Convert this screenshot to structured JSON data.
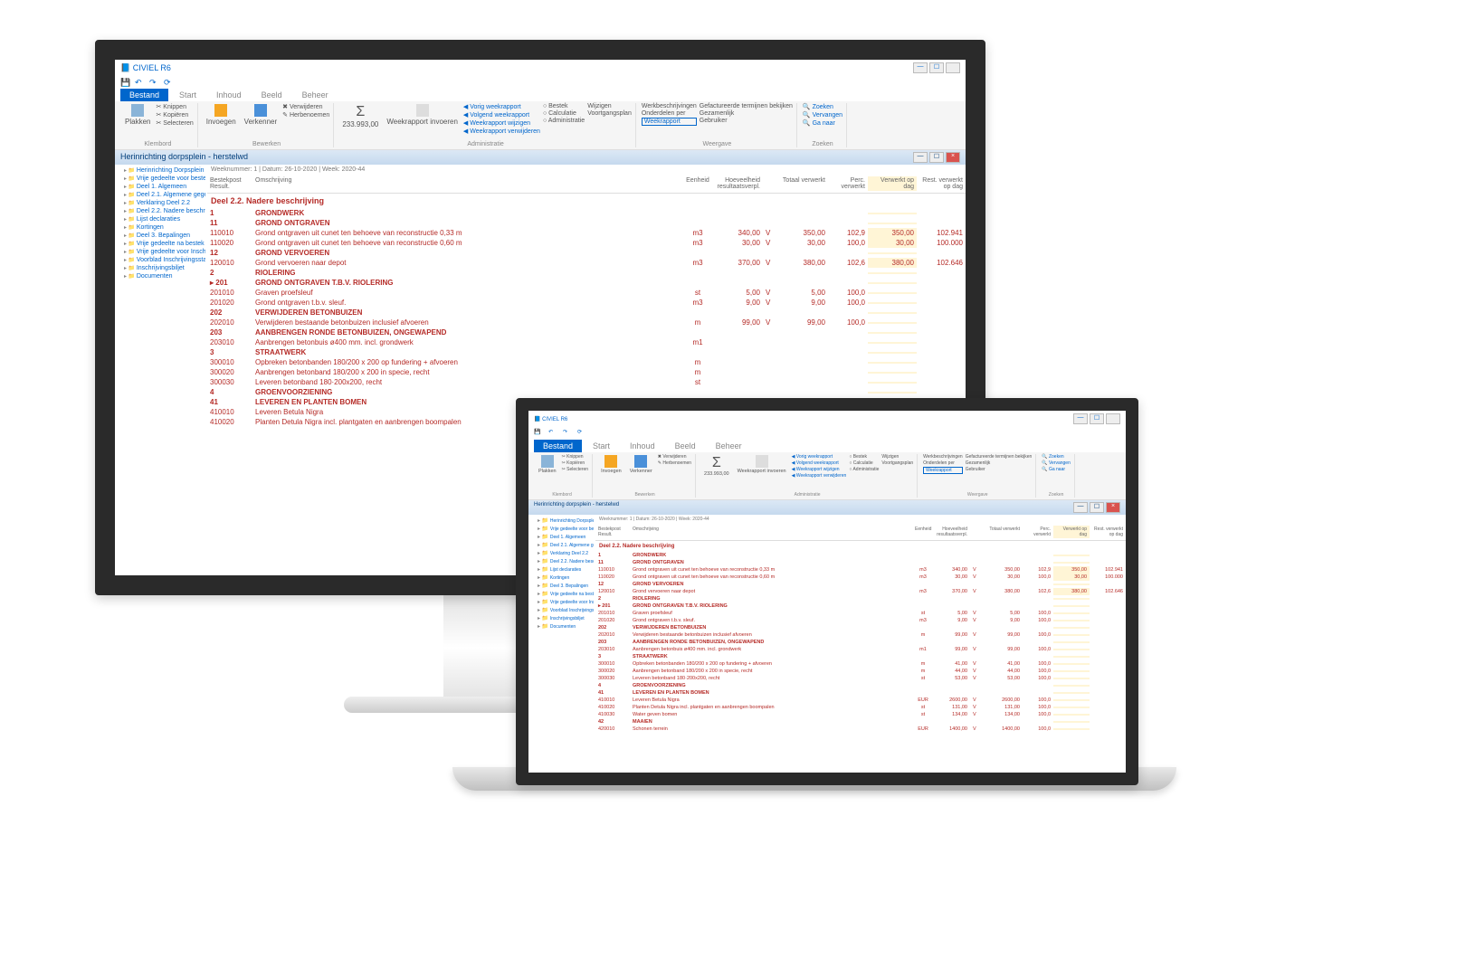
{
  "app_title": "CIVIEL R6",
  "tabs": [
    "Bestand",
    "Start",
    "Inhoud",
    "Beeld",
    "Beheer"
  ],
  "ribbon": {
    "klembord": {
      "label": "Klembord",
      "items": [
        "Knippen",
        "Kopiëren",
        "Selecteren"
      ],
      "big": "Plakken"
    },
    "bewerken": {
      "label": "Bewerken",
      "invoegen": "Invoegen",
      "verkenner": "Verkenner",
      "verwijderen": "Verwijderen",
      "herbenoemen": "Herbenoemen"
    },
    "totaal": "233.993,00",
    "admin": {
      "label": "Administratie",
      "weekrapport": "Weekrapport\ninvoeren",
      "items": [
        "Vorig weekrapport",
        "Volgend weekrapport",
        "Weekrapport wijzigen",
        "Weekrapport verwijderen"
      ],
      "col2": [
        "Bestek",
        "Calculatie",
        "Administratie"
      ],
      "col3": [
        "Wijzigen",
        "Voortgangsplan"
      ]
    },
    "weergave": {
      "label": "Weergave",
      "items": [
        "Werkbeschrijvingen",
        "Onderdelen per",
        "Weekrapport"
      ],
      "col2": [
        "Gefactureerde termijnen bekijken",
        "Gezamenlijk",
        "Gebruiker"
      ]
    },
    "zoeken": {
      "label": "Zoeken",
      "items": [
        "Zoeken",
        "Vervangen",
        "Ga naar"
      ]
    }
  },
  "doc_title": "Herinrichting dorpsplein - herstelwd",
  "tree": [
    "Herinrichting Dorpsplein",
    "Vrije gedeelte voor bestek",
    "Deel 1. Algemeen",
    "Deel 2.1. Algemene gegev",
    "Verklaring Deel 2.2",
    "Deel 2.2. Nadere beschrij",
    "Lijst declaraties",
    "Kortingen",
    "Deel 3. Bepalingen",
    "Vrije gedeelte na bestek",
    "Vrije gedeelte voor Inschr",
    "Voorblad Inschrijvingsstaa",
    "Inschrijvingsbiljet",
    "Documenten"
  ],
  "meta_line": "Weeknummer: 1  |  Datum: 26-10-2020  |  Week: 2020-44",
  "cols": {
    "bestek": "Bestekpost\nResult.",
    "omschr": "Omschrijving",
    "eh": "Eenheid",
    "hv": "Hoeveelheid\nresultaatsverpl.",
    "v": "",
    "tot": "Totaal\nverwerkt",
    "pct": "Perc.\nverwerkt",
    "vw": "Verwerkt\nop dag",
    "rv": "Rest. verwerkt\nop dag"
  },
  "section_title": "Deel 2.2. Nadere beschrijving",
  "rows": [
    {
      "code": "1",
      "desc": "GRONDWERK",
      "bold": true
    },
    {
      "code": "11",
      "desc": "GROND ONTGRAVEN",
      "bold": true
    },
    {
      "code": "110010",
      "desc": "Grond ontgraven uit cunet ten behoeve van reconstructie 0,33 m",
      "eh": "m3",
      "hv": "340,00",
      "v": "V",
      "tot": "350,00",
      "pct": "102,9",
      "vw": "350,00",
      "rv": "102.941"
    },
    {
      "code": "110020",
      "desc": "Grond ontgraven uit cunet ten behoeve van reconstructie 0,60 m",
      "eh": "m3",
      "hv": "30,00",
      "v": "V",
      "tot": "30,00",
      "pct": "100,0",
      "vw": "30,00",
      "rv": "100.000"
    },
    {
      "code": "12",
      "desc": "GROND VERVOEREN",
      "bold": true
    },
    {
      "code": "120010",
      "desc": "Grond vervoeren naar depot",
      "eh": "m3",
      "hv": "370,00",
      "v": "V",
      "tot": "380,00",
      "pct": "102,6",
      "vw": "380,00",
      "rv": "102.646"
    },
    {
      "code": "2",
      "desc": "RIOLERING",
      "bold": true
    },
    {
      "code": "201",
      "desc": "GROND ONTGRAVEN T.B.V. RIOLERING",
      "bold": true,
      "mark": true
    },
    {
      "code": "201010",
      "desc": "Graven proefsleuf",
      "eh": "st",
      "hv": "5,00",
      "v": "V",
      "tot": "5,00",
      "pct": "100,0"
    },
    {
      "code": "201020",
      "desc": "Grond ontgraven t.b.v. sleuf.",
      "eh": "m3",
      "hv": "9,00",
      "v": "V",
      "tot": "9,00",
      "pct": "100,0"
    },
    {
      "code": "202",
      "desc": "VERWIJDEREN BETONBUIZEN",
      "bold": true
    },
    {
      "code": "202010",
      "desc": "Verwijderen bestaande betonbuizen inclusief afvoeren",
      "eh": "m",
      "hv": "99,00",
      "v": "V",
      "tot": "99,00",
      "pct": "100,0"
    },
    {
      "code": "203",
      "desc": "AANBRENGEN RONDE BETONBUIZEN, ONGEWAPEND",
      "bold": true
    },
    {
      "code": "203010",
      "desc": "Aanbrengen betonbuis ø400 mm. incl. grondwerk",
      "eh": "m1"
    },
    {
      "code": "3",
      "desc": "STRAATWERK",
      "bold": true
    },
    {
      "code": "300010",
      "desc": "Opbreken betonbanden 180/200 x 200 op fundering + afvoeren",
      "eh": "m"
    },
    {
      "code": "300020",
      "desc": "Aanbrengen betonband 180/200 x 200 in specie, recht",
      "eh": "m"
    },
    {
      "code": "300030",
      "desc": "Leveren betonband 180·200x200, recht",
      "eh": "st"
    },
    {
      "code": "4",
      "desc": "GROENVOORZIENING",
      "bold": true
    },
    {
      "code": "41",
      "desc": "LEVEREN EN PLANTEN BOMEN",
      "bold": true
    },
    {
      "code": "410010",
      "desc": "Leveren Betula Nigra",
      "eh": "EUR"
    },
    {
      "code": "410020",
      "desc": "Planten Detula Nigra incl. plantgaten en aanbrengen boompalen",
      "eh": "st"
    }
  ],
  "rows_laptop_extra": [
    {
      "code": "203010",
      "desc": "Aanbrengen betonbuis ø400 mm. incl. grondwerk",
      "eh": "m1",
      "hv": "99,00",
      "v": "V",
      "tot": "99,00",
      "pct": "100,0"
    },
    {
      "code": "3",
      "desc": "STRAATWERK",
      "bold": true
    },
    {
      "code": "300010",
      "desc": "Opbreken betonbanden 180/200 x 200 op fundering + afvoeren",
      "eh": "m",
      "hv": "41,00",
      "v": "V",
      "tot": "41,00",
      "pct": "100,0"
    },
    {
      "code": "300020",
      "desc": "Aanbrengen betonband 180/200 x 200 in specie, recht",
      "eh": "m",
      "hv": "44,00",
      "v": "V",
      "tot": "44,00",
      "pct": "100,0"
    },
    {
      "code": "300030",
      "desc": "Leveren betonband 180·200x200, recht",
      "eh": "st",
      "hv": "53,00",
      "v": "V",
      "tot": "53,00",
      "pct": "100,0"
    },
    {
      "code": "4",
      "desc": "GROENVOORZIENING",
      "bold": true
    },
    {
      "code": "41",
      "desc": "LEVEREN EN PLANTEN BOMEN",
      "bold": true
    },
    {
      "code": "410010",
      "desc": "Leveren Betula Nigra",
      "eh": "EUR",
      "hv": "2600,00",
      "v": "V",
      "tot": "2600,00",
      "pct": "100,0"
    },
    {
      "code": "410020",
      "desc": "Planten Detula Nigra incl. plantgaten en aanbrengen boompalen",
      "eh": "st",
      "hv": "131,00",
      "v": "V",
      "tot": "131,00",
      "pct": "100,0"
    },
    {
      "code": "410030",
      "desc": "Water geven bomen",
      "eh": "st",
      "hv": "134,00",
      "v": "V",
      "tot": "134,00",
      "pct": "100,0"
    },
    {
      "code": "42",
      "desc": "MAAIEN",
      "bold": true
    },
    {
      "code": "420010",
      "desc": "Schonen terrein",
      "eh": "EUR",
      "hv": "1400,00",
      "v": "V",
      "tot": "1400,00",
      "pct": "100,0"
    }
  ]
}
